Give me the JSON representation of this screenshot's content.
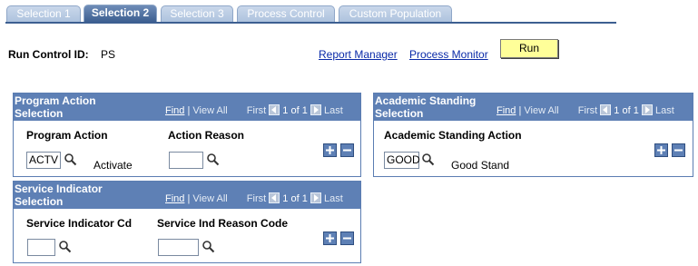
{
  "tabs": [
    {
      "label": "Selection 1"
    },
    {
      "label": "Selection 2"
    },
    {
      "label": "Selection 3"
    },
    {
      "label": "Process Control"
    },
    {
      "label": "Custom Population"
    }
  ],
  "run_control": {
    "label": "Run Control ID:",
    "value": "PS"
  },
  "links": {
    "report_manager": "Report Manager",
    "process_monitor": "Process Monitor"
  },
  "run_button": {
    "label": "Run"
  },
  "grid_nav": {
    "find": "Find",
    "sep": "|",
    "view_all": "View All",
    "first": "First",
    "range": "1 of 1",
    "last": "Last"
  },
  "program_action_grid": {
    "title": "Program Action Selection",
    "col_action": "Program Action",
    "col_reason": "Action Reason",
    "action_value": "ACTV",
    "action_desc": "Activate",
    "reason_value": ""
  },
  "academic_standing_grid": {
    "title": "Academic Standing Selection",
    "col_action": "Academic Standing Action",
    "action_value": "GOOD",
    "action_desc": "Good Stand"
  },
  "service_indicator_grid": {
    "title": "Service Indicator Selection",
    "col_cd": "Service Indicator Cd",
    "col_reason": "Service Ind Reason Code",
    "cd_value": "",
    "reason_value": ""
  },
  "colors": {
    "tab_active": "#3d5f91",
    "grid_header": "#5e80b5",
    "run_button": "#ffff99",
    "link": "#0a2aa8"
  }
}
